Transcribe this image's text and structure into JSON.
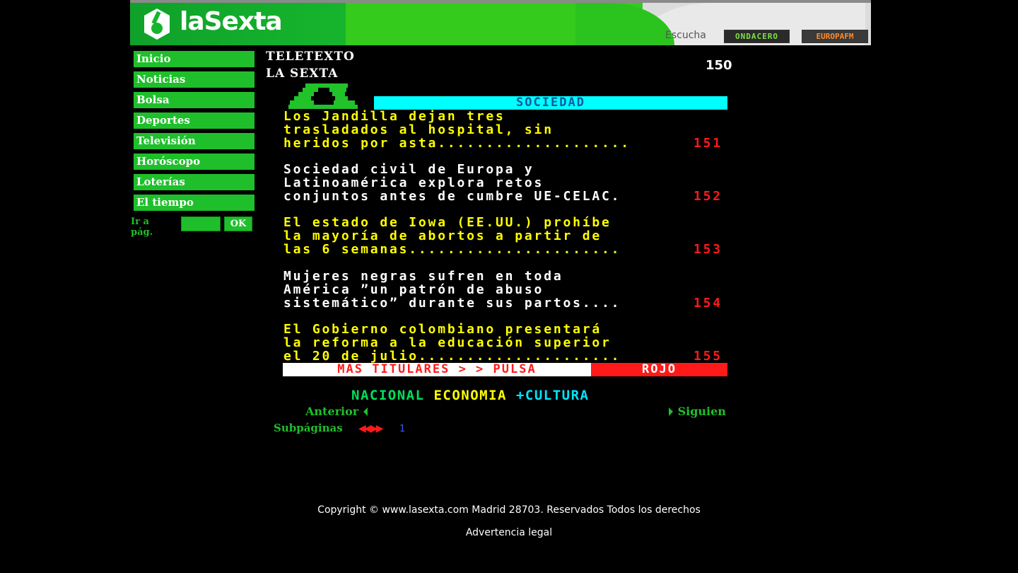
{
  "header": {
    "logo_text": "laSexta",
    "escucha_label": "Escucha",
    "radio_badges": [
      "ONDACERO",
      "EUROPAFM"
    ]
  },
  "sidebar": {
    "items": [
      {
        "label": "Inicio"
      },
      {
        "label": "Noticias"
      },
      {
        "label": "Bolsa"
      },
      {
        "label": "Deportes"
      },
      {
        "label": "Televisión"
      },
      {
        "label": "Horóscopo"
      },
      {
        "label": "Loterías"
      },
      {
        "label": "El tiempo"
      }
    ],
    "goto_label": "Ir a pág.",
    "goto_value": "",
    "goto_button": "OK"
  },
  "teletext": {
    "title_line1": "TELETEXTO",
    "title_line2": "LA SEXTA",
    "page_number": "150",
    "section_title": "SOCIEDAD",
    "headlines": [
      {
        "lines": [
          "Los Jandilla dejan tres",
          "trasladados al hospital, sin",
          "heridos por asta...................."
        ],
        "page": "151",
        "color": "yellow"
      },
      {
        "lines": [
          "Sociedad civil de Europa y",
          "Latinoamérica explora retos",
          "conjuntos antes de cumbre UE-CELAC."
        ],
        "page": "152",
        "color": "white"
      },
      {
        "lines": [
          "El estado de Iowa (EE.UU.) prohíbe",
          "la mayoría de abortos a partir de",
          "las 6 semanas......................"
        ],
        "page": "153",
        "color": "yellow"
      },
      {
        "lines": [
          "Mujeres negras sufren en toda",
          "América ”un patrón de abuso",
          "sistemático” durante sus partos...."
        ],
        "page": "154",
        "color": "white"
      },
      {
        "lines": [
          "El Gobierno colombiano presentará",
          "la reforma a la educación superior",
          "el 20 de julio....................."
        ],
        "page": "155",
        "color": "yellow"
      }
    ],
    "more_bar_left": "MAS TITULARES > > PULSA",
    "more_bar_right": "ROJO",
    "sections": {
      "nacional": "NACIONAL",
      "economia": "ECONOMIA",
      "cultura": "+CULTURA"
    },
    "prev_label": "Anterior",
    "next_label": "Siguien",
    "subpages_label": "Subpáginas",
    "subpage_arrows": "◀◀ ▶▶",
    "subpage_number": "1"
  },
  "footer": {
    "copyright": "Copyright © www.lasexta.com Madrid 28703. Reservados Todos los derechos",
    "legal": "Advertencia legal"
  },
  "colors": {
    "background": "#000000",
    "brand_green": "#1fbf2b",
    "teletext_yellow": "#ffff00",
    "teletext_red": "#ff1a1a",
    "teletext_cyan": "#00ffff"
  }
}
